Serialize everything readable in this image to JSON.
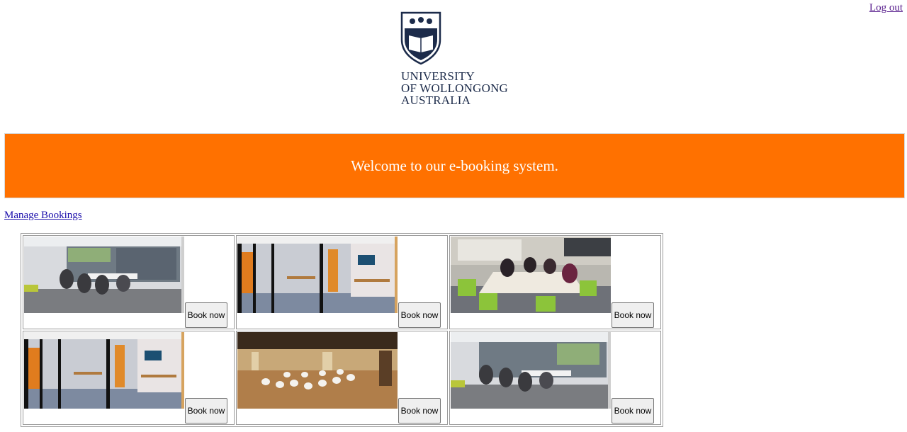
{
  "header": {
    "logout_label": "Log out",
    "logo": {
      "line1": "UNIVERSITY",
      "line2": "OF WOLLONGONG",
      "line3": "AUSTRALIA",
      "crest_color": "#1c2b4a"
    }
  },
  "banner": {
    "text": "Welcome to our e-booking system.",
    "background": "#ff7100"
  },
  "nav": {
    "manage_bookings_label": "Manage Bookings"
  },
  "rooms": [
    {
      "image": "meeting-room-photo",
      "button_label": "Book now"
    },
    {
      "image": "glass-study-room-photo",
      "button_label": "Book now"
    },
    {
      "image": "group-study-photo",
      "button_label": "Book now"
    },
    {
      "image": "glass-study-room-photo",
      "button_label": "Book now"
    },
    {
      "image": "lecture-hall-photo",
      "button_label": "Book now"
    },
    {
      "image": "meeting-room-photo",
      "button_label": "Book now"
    }
  ]
}
